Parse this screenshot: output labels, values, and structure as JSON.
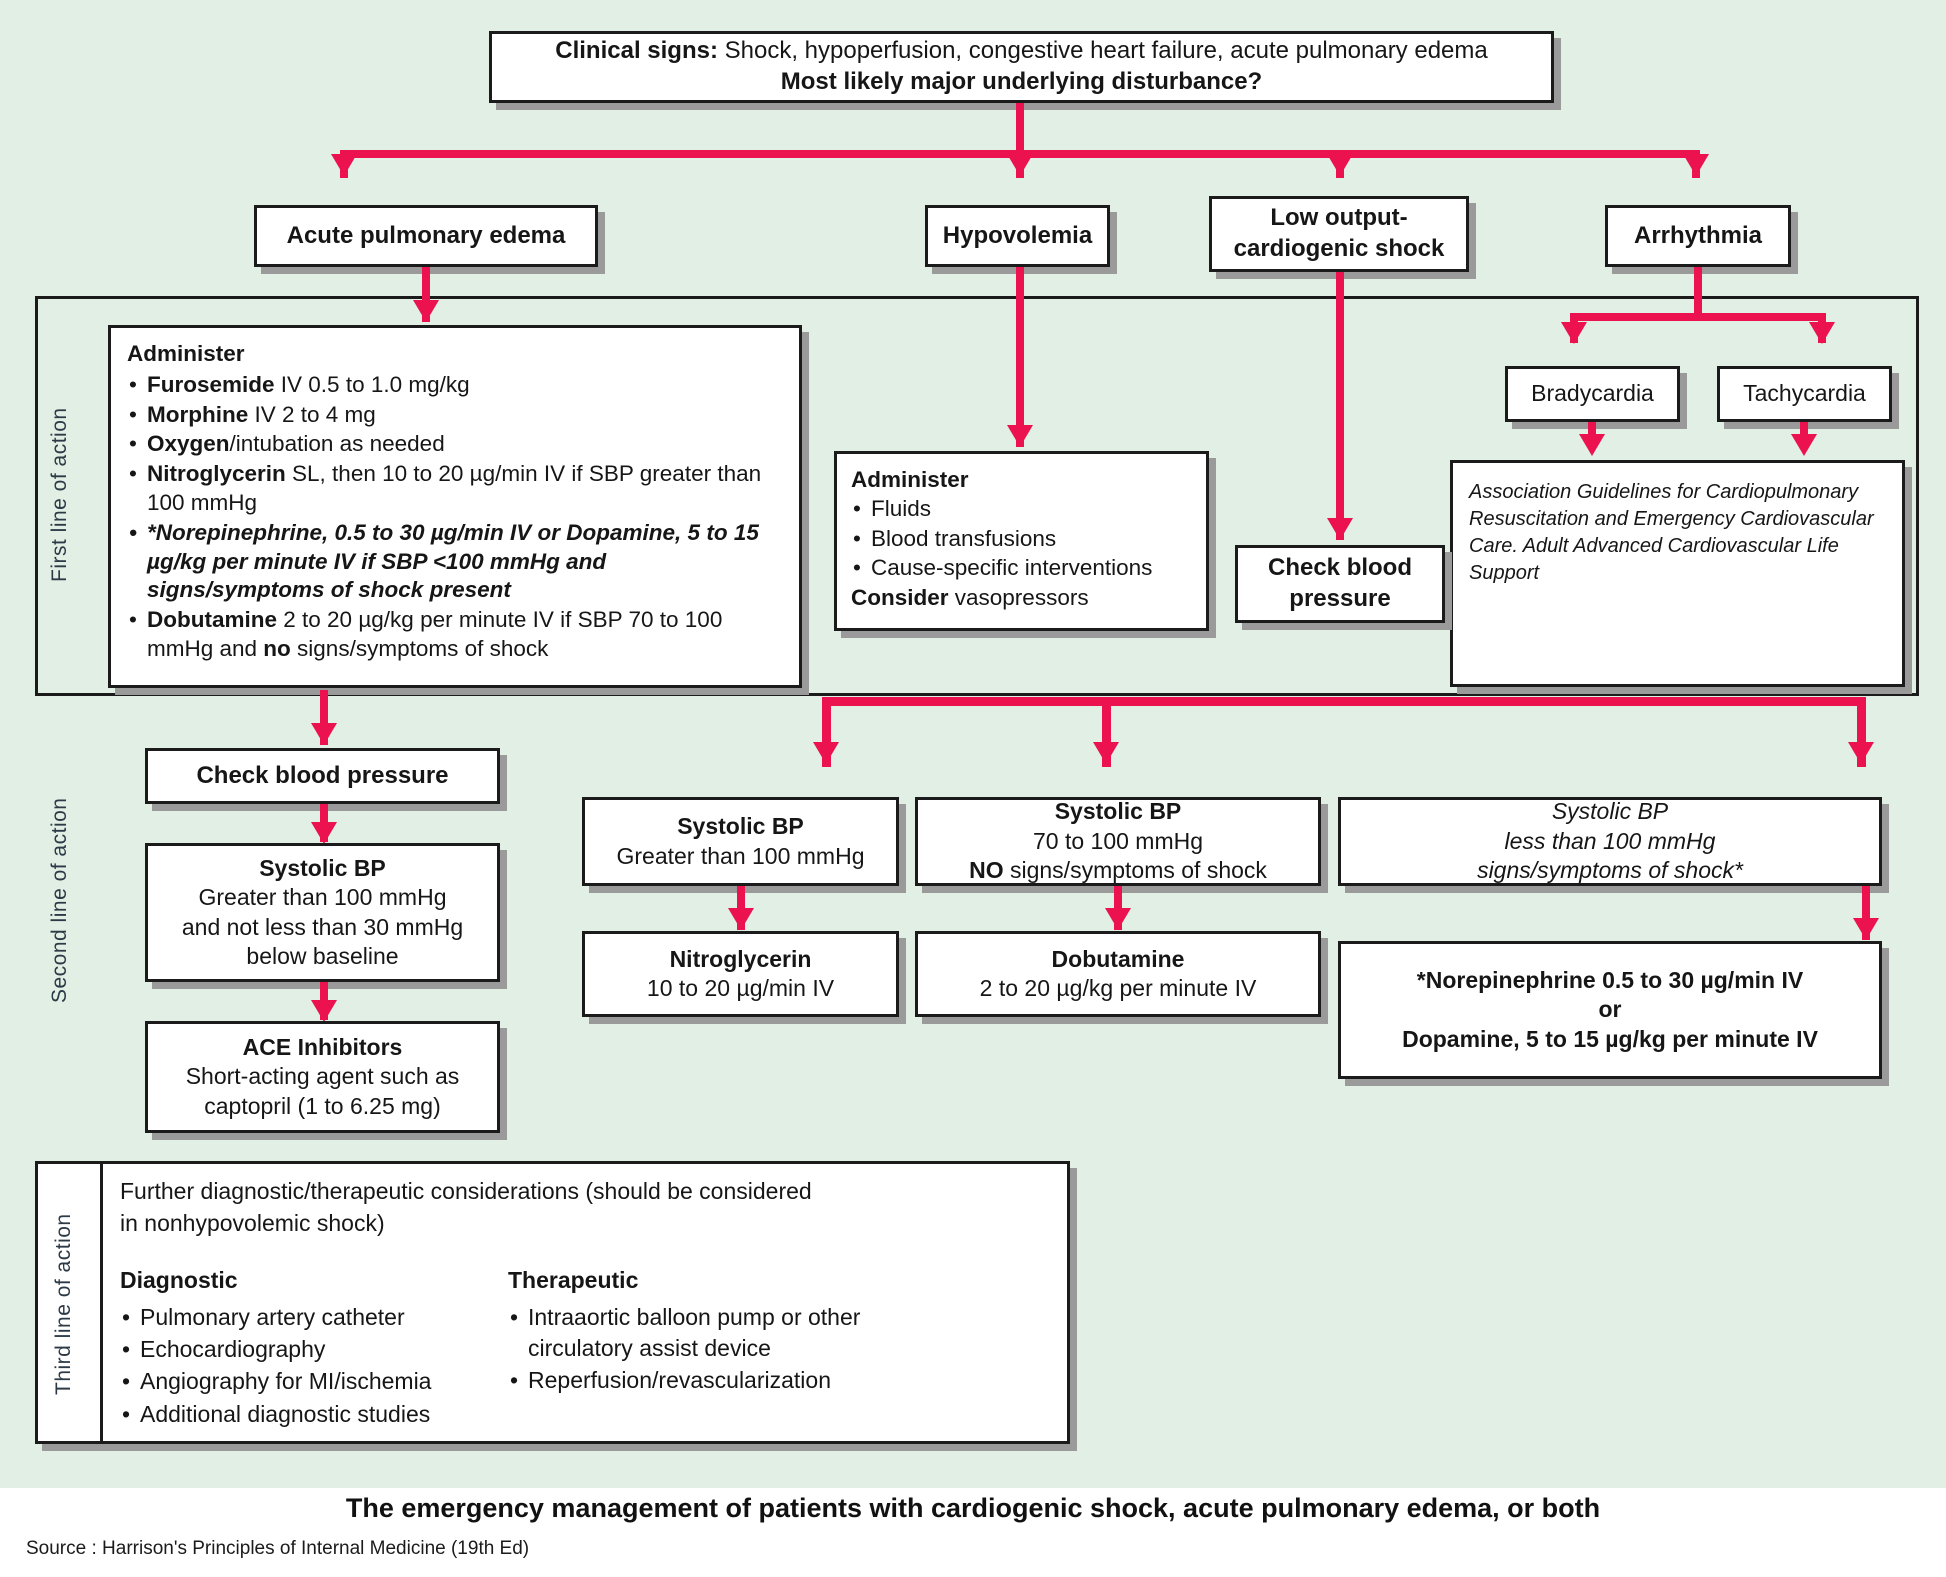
{
  "caption": "The emergency management of patients with cardiogenic shock, acute pulmonary edema, or both",
  "source": "Source : Harrison's Principles of Internal Medicine (19th Ed)",
  "colors": {
    "background": "#e2efe5",
    "arrow": "#ec1250",
    "box_border": "#1b1b1b",
    "box_fill": "#ffffff",
    "shadow": "#9a9a9a",
    "label_text": "#2b3a46"
  },
  "lanes": {
    "first": "First line of action",
    "second": "Second line of action",
    "third": "Third line of action"
  },
  "root": {
    "line1_bold": "Clinical signs:",
    "line1_rest": " Shock, hypoperfusion, congestive heart failure, acute pulmonary edema",
    "line2": "Most likely major underlying disturbance?"
  },
  "branches": {
    "pulmonary_edema": "Acute pulmonary edema",
    "hypovolemia": "Hypovolemia",
    "low_output": "Low output-\ncardiogenic shock",
    "low_output_l1": "Low output-",
    "low_output_l2": "cardiogenic shock",
    "arrhythmia": "Arrhythmia",
    "bradycardia": "Bradycardia",
    "tachycardia": "Tachycardia"
  },
  "administer_edema": {
    "heading": "Administer",
    "items": [
      {
        "bold": "Furosemide",
        "rest": " IV 0.5 to 1.0 mg/kg",
        "style": "normal"
      },
      {
        "bold": "Morphine",
        "rest": " IV 2 to 4 mg",
        "style": "normal"
      },
      {
        "bold": "Oxygen",
        "rest": "/intubation as needed",
        "style": "normal"
      },
      {
        "bold": "Nitroglycerin",
        "rest": " SL, then 10 to 20 µg/min IV if SBP greater than 100 mmHg",
        "style": "normal"
      },
      {
        "bold": "*Norepinephrine, 0.5 to 30 µg/min IV or Dopamine, 5 to 15 µg/kg per minute IV if SBP <100 mmHg and signs/symptoms of shock present",
        "rest": "",
        "style": "bolditalic"
      },
      {
        "bold": "Dobutamine",
        "rest": " 2 to 20 µg/kg per minute IV if SBP 70 to 100 mmHg and ",
        "style": "normal",
        "bold2": "no",
        "rest2": " signs/symptoms of shock"
      }
    ]
  },
  "administer_hypovolemia": {
    "heading": "Administer",
    "items": [
      "Fluids",
      "Blood transfusions",
      "Cause-specific interventions"
    ],
    "consider_bold": "Consider",
    "consider_rest": " vasopressors"
  },
  "check_bp_right": "Check blood\npressure",
  "check_bp_right_l1": "Check blood",
  "check_bp_right_l2": "pressure",
  "aha_guidelines": "Association Guidelines for Cardiopulmonary Resuscitation and Emergency Cardiovascular Care.  Adult Advanced Cardiovascular Life Support",
  "second_line": {
    "check_bp": "Check blood pressure",
    "col_left": {
      "bp_title": "Systolic BP",
      "bp_l1": "Greater than 100 mmHg",
      "bp_l2": "and not less than 30 mmHg",
      "bp_l3": "below baseline",
      "treat_title": "ACE Inhibitors",
      "treat_l1": "Short-acting agent such as",
      "treat_l2": "captopril (1 to 6.25 mg)"
    },
    "col_a": {
      "bp_title": "Systolic BP",
      "bp_l1": "Greater than 100 mmHg",
      "treat_title": "Nitroglycerin",
      "treat_l1": "10 to 20 µg/min IV"
    },
    "col_b": {
      "bp_title": "Systolic BP",
      "bp_l1": "70 to 100 mmHg",
      "bp_l2_bold": "NO",
      "bp_l2_rest": " signs/symptoms of shock",
      "treat_title": "Dobutamine",
      "treat_l1": "2 to 20 µg/kg per minute IV"
    },
    "col_c": {
      "bp_l1": "Systolic BP",
      "bp_l2": "less than 100 mmHg",
      "bp_l3": "signs/symptoms of shock*",
      "treat_l1": "*Norepinephrine 0.5 to 30 µg/min IV",
      "treat_l2": "or",
      "treat_l3": "Dopamine, 5 to 15 µg/kg per minute IV"
    }
  },
  "third_line": {
    "intro_l1": "Further diagnostic/therapeutic considerations (should be considered",
    "intro_l2": "in nonhypovolemic shock)",
    "diagnostic_heading": "Diagnostic",
    "diagnostic_items": [
      "Pulmonary artery catheter",
      "Echocardiography",
      "Angiography for MI/ischemia",
      "Additional diagnostic studies"
    ],
    "therapeutic_heading": "Therapeutic",
    "therapeutic_items": [
      "Intraaortic balloon pump or other circulatory assist device",
      "Reperfusion/revascularization"
    ]
  }
}
